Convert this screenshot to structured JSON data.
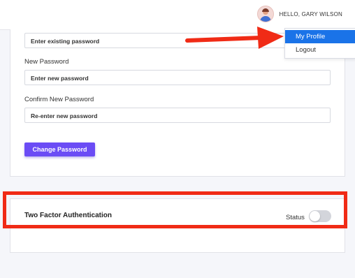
{
  "header": {
    "greeting": "HELLO, GARY WILSON",
    "avatar_icon": "user-avatar-icon"
  },
  "user_menu": {
    "items": [
      {
        "label": "My Profile",
        "active": true
      },
      {
        "label": "Logout",
        "active": false
      }
    ],
    "active_color": "#1a73e8"
  },
  "password_form": {
    "current_placeholder": "Enter existing password",
    "new_label": "New Password",
    "new_placeholder": "Enter new password",
    "confirm_label": "Confirm New Password",
    "confirm_placeholder": "Re-enter new password",
    "submit_label": "Change Password",
    "button_color": "#6b4cf5"
  },
  "two_factor": {
    "title": "Two Factor Authentication",
    "status_label": "Status",
    "enabled": false
  },
  "annotations": {
    "color": "#f02b16",
    "arrow_icon": "arrow-right-icon"
  }
}
